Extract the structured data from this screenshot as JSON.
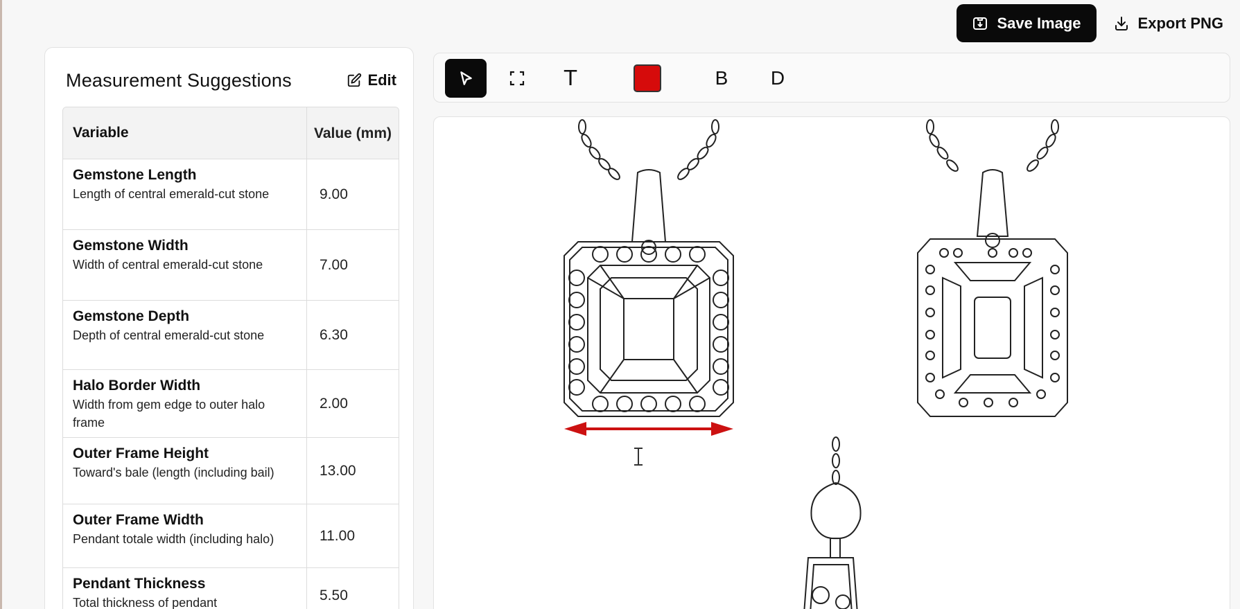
{
  "header": {
    "save_label": "Save Image",
    "export_label": "Export PNG"
  },
  "panel": {
    "title": "Measurement Suggestions",
    "edit_label": "Edit",
    "table": {
      "col_variable": "Variable",
      "col_value": "Value (mm)",
      "rows": [
        {
          "name": "Gemstone Length",
          "desc": "Length of central emerald-cut stone",
          "value": "9.00"
        },
        {
          "name": "Gemstone Width",
          "desc": "Width of central emerald-cut stone",
          "value": "7.00"
        },
        {
          "name": "Gemstone Depth",
          "desc": "Depth of central emerald-cut stone",
          "value": "6.30"
        },
        {
          "name": "Halo Border Width",
          "desc": "Width from gem edge to outer halo frame",
          "value": "2.00"
        },
        {
          "name": "Outer Frame Height",
          "desc": "Toward's bale (length (including bail)",
          "value": "13.00"
        },
        {
          "name": "Outer Frame Width",
          "desc": "Pendant totale width (including halo)",
          "value": "11.00"
        },
        {
          "name": "Pendant Thickness",
          "desc": "Total thickness of pendant",
          "value": "5.50"
        }
      ]
    }
  },
  "toolbar": {
    "text_tool": "T",
    "b_label": "B",
    "d_label": "D",
    "active_color": "#d60b0b"
  },
  "icons": {
    "save": "save-image-icon",
    "export": "download-icon",
    "edit": "edit-icon",
    "select": "select-pointer-icon",
    "crop": "crop-frame-icon",
    "cursor": "text-cursor-icon"
  },
  "accent_color": "#0a0a0a",
  "arrow_color": "#cc1111"
}
